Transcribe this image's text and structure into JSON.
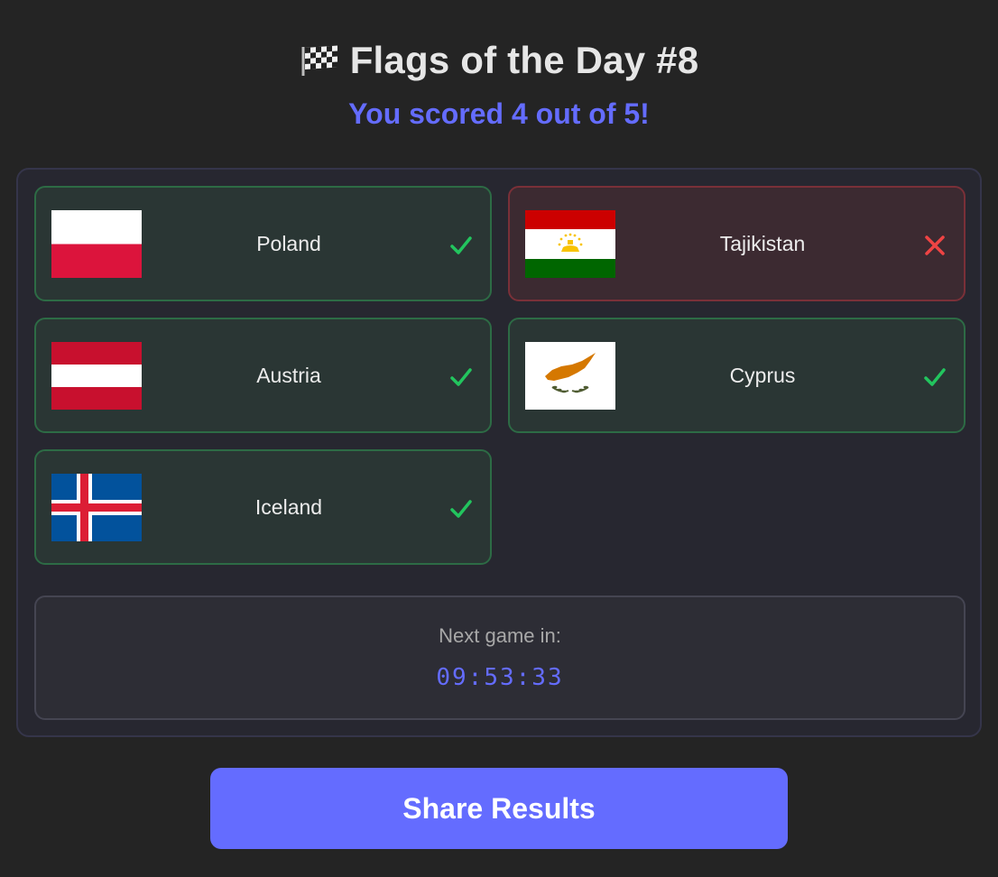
{
  "header": {
    "icon": "checkered-flag-icon",
    "title": "Flags of the Day #8",
    "score_text": "You scored 4 out of 5!"
  },
  "results": [
    {
      "country": "Poland",
      "flag": "poland-flag-icon",
      "status": "correct"
    },
    {
      "country": "Tajikistan",
      "flag": "tajikistan-flag-icon",
      "status": "wrong"
    },
    {
      "country": "Austria",
      "flag": "austria-flag-icon",
      "status": "correct"
    },
    {
      "country": "Cyprus",
      "flag": "cyprus-flag-icon",
      "status": "correct"
    },
    {
      "country": "Iceland",
      "flag": "iceland-flag-icon",
      "status": "correct"
    }
  ],
  "timer": {
    "label": "Next game in:",
    "value": "09:53:33"
  },
  "share_button": {
    "label": "Share Results"
  },
  "colors": {
    "accent": "#646cff",
    "correct": "#22c55e",
    "wrong": "#ef4444",
    "background": "#242424"
  }
}
